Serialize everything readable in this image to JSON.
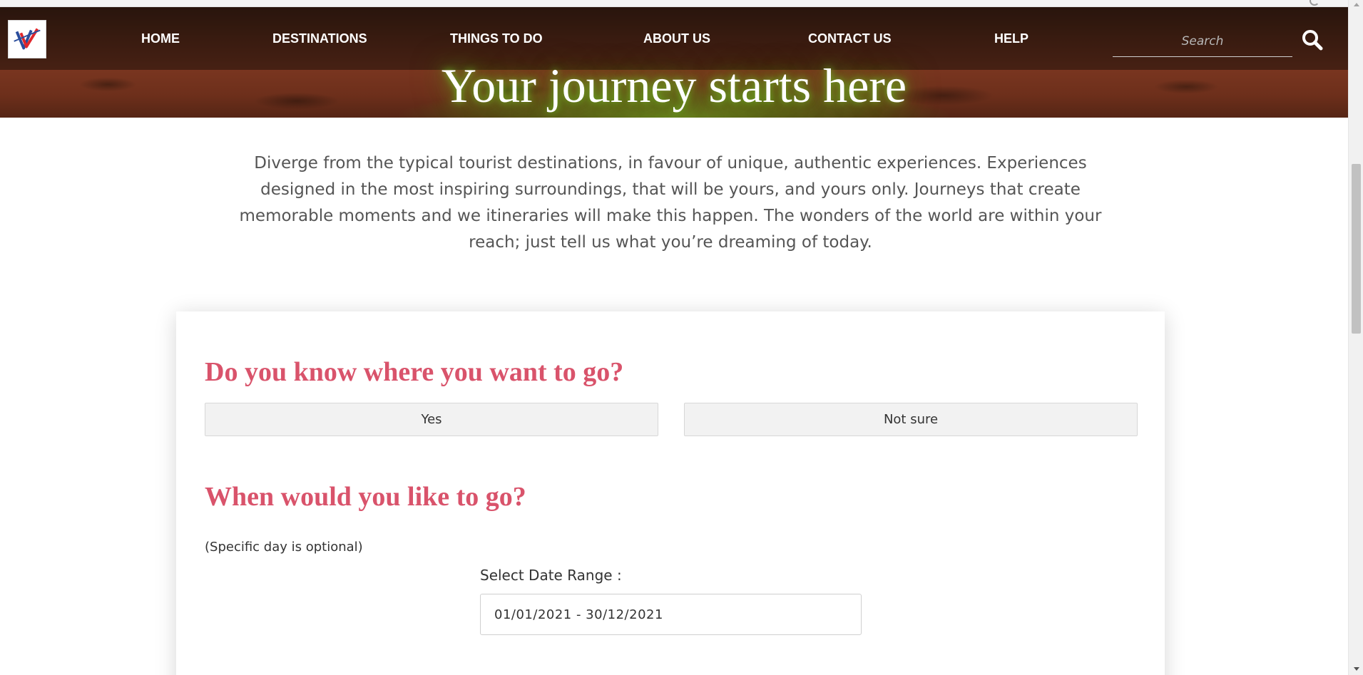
{
  "nav": {
    "logo_icon": "vv-travel-logo",
    "items": [
      {
        "label": "HOME"
      },
      {
        "label": "DESTINATIONS"
      },
      {
        "label": "THINGS TO DO"
      },
      {
        "label": "ABOUT US"
      },
      {
        "label": "CONTACT US"
      },
      {
        "label": "HELP"
      }
    ],
    "search": {
      "placeholder": "Search",
      "value": "",
      "icon": "search-icon"
    }
  },
  "hero": {
    "title": "Your journey starts here"
  },
  "intro": {
    "text": "Diverge from the typical tourist destinations, in favour of unique, authentic experiences. Experiences designed in the most inspiring surroundings, that will be yours, and yours only. Journeys that create memorable moments and we itineraries will make this happen. The wonders of the world are within your reach; just tell us what you’re dreaming of today."
  },
  "form": {
    "destination_question": "Do you know where you want to go?",
    "options": [
      {
        "label": "Yes"
      },
      {
        "label": "Not sure"
      }
    ],
    "date_question": "When would you like to go?",
    "date_hint": "(Specific day is optional)",
    "date_label": "Select Date Range :",
    "date_value": "01/01/2021 - 30/12/2021"
  },
  "colors": {
    "accent_heading": "#d9536b",
    "hero_glow": "#7ac83a",
    "nav_text": "#ffffff"
  }
}
